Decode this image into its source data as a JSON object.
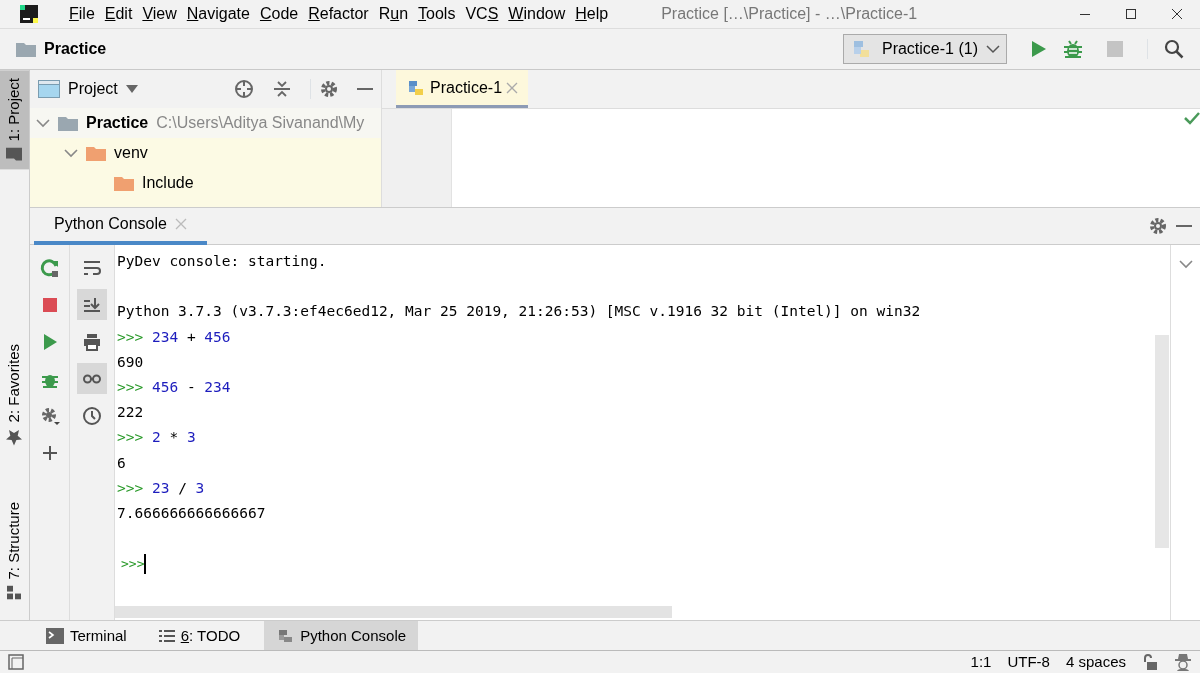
{
  "window": {
    "title": "Practice […\\Practice] - …\\Practice-1"
  },
  "menu": [
    {
      "key": "F",
      "after": "ile"
    },
    {
      "key": "E",
      "after": "dit"
    },
    {
      "key": "V",
      "after": "iew"
    },
    {
      "key": "N",
      "after": "avigate"
    },
    {
      "key": "C",
      "after": "ode"
    },
    {
      "key": "R",
      "after": "efactor"
    },
    {
      "before": "R",
      "key": "u",
      "after": "n"
    },
    {
      "key": "T",
      "after": "ools"
    },
    {
      "before": "VC",
      "key": "S"
    },
    {
      "key": "W",
      "after": "indow"
    },
    {
      "key": "H",
      "after": "elp"
    }
  ],
  "navbar": {
    "breadcrumb": "Practice",
    "run_config": "Practice-1 (1)",
    "stop_disabled": true
  },
  "left_stripe": [
    {
      "label": "1: Project",
      "selected": true
    },
    {
      "label": "2: Favorites",
      "selected": false
    },
    {
      "label": "7: Structure",
      "selected": false
    }
  ],
  "project_panel": {
    "view": "Project",
    "tree": [
      {
        "name": "Practice",
        "path": "C:\\Users\\Aditya Sivanand\\My",
        "kind": "root",
        "selected": true,
        "expanded": true,
        "children": [
          {
            "name": "venv",
            "kind": "folder",
            "selected": false,
            "expanded": true,
            "children": [
              {
                "name": "Include",
                "kind": "folder",
                "selected": false
              }
            ]
          }
        ]
      }
    ]
  },
  "editor_tabs": [
    {
      "label": "Practice-1",
      "selected": true
    }
  ],
  "console": {
    "title": "Python Console",
    "lines": [
      {
        "kind": "output",
        "text": "PyDev console: starting."
      },
      {
        "kind": "blank"
      },
      {
        "kind": "output",
        "text": "Python 3.7.3 (v3.7.3:ef4ec6ed12, Mar 25 2019, 21:26:53) [MSC v.1916 32 bit (Intel)] on win32"
      },
      {
        "kind": "input",
        "prompt": ">>>",
        "tokens": [
          {
            "text": "234",
            "kind": "number"
          },
          {
            "text": "+",
            "kind": "op"
          },
          {
            "text": "456",
            "kind": "number"
          }
        ]
      },
      {
        "kind": "output",
        "text": "690"
      },
      {
        "kind": "input",
        "prompt": ">>>",
        "tokens": [
          {
            "text": "456",
            "kind": "number"
          },
          {
            "text": "-",
            "kind": "op"
          },
          {
            "text": "234",
            "kind": "number"
          }
        ]
      },
      {
        "kind": "output",
        "text": "222"
      },
      {
        "kind": "input",
        "prompt": ">>>",
        "tokens": [
          {
            "text": "2",
            "kind": "number"
          },
          {
            "text": "*",
            "kind": "op"
          },
          {
            "text": "3",
            "kind": "number"
          }
        ]
      },
      {
        "kind": "output",
        "text": "6"
      },
      {
        "kind": "input",
        "prompt": ">>>",
        "tokens": [
          {
            "text": "23",
            "kind": "number"
          },
          {
            "text": "/",
            "kind": "op"
          },
          {
            "text": "3",
            "kind": "number"
          }
        ]
      },
      {
        "kind": "output",
        "text": "7.666666666666667"
      },
      {
        "kind": "blank"
      },
      {
        "kind": "prompt",
        "prompt": ">>>"
      }
    ]
  },
  "bottom_tabs": [
    {
      "after": "Terminal",
      "selected": false
    },
    {
      "key": "6",
      "after": ": TODO",
      "selected": false
    },
    {
      "after": "Python Console",
      "selected": true
    }
  ],
  "status_bar": {
    "position": "1:1",
    "encoding": "UTF-8",
    "indent": "4 spaces"
  }
}
